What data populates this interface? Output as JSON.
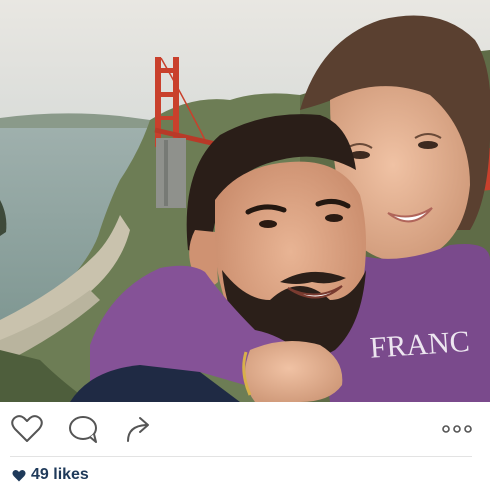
{
  "post": {
    "photo": {
      "icon": "selfie-photo",
      "sweatshirt_text": "FRANC"
    },
    "actions": {
      "like_icon": "heart-outline-icon",
      "comment_icon": "speech-bubble-icon",
      "share_icon": "share-arrow-icon",
      "more_icon": "ellipsis-icon"
    },
    "likes": {
      "icon": "heart-filled-icon",
      "label": "49 likes"
    }
  },
  "colors": {
    "icon_stroke": "#555555",
    "likes_text": "#1f3a5a",
    "divider": "#e3e3e3",
    "bridge": "#c9402c",
    "hoodie": "#7a4a8c"
  }
}
